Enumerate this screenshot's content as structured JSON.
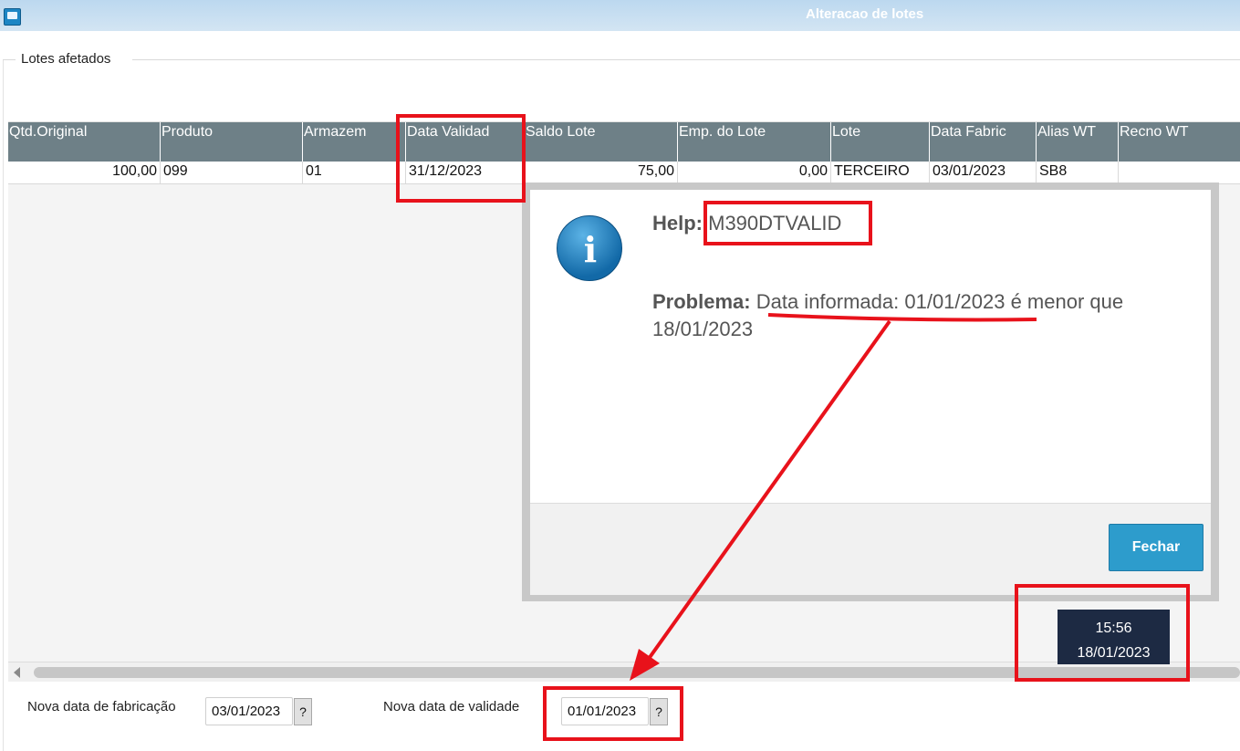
{
  "window": {
    "title": "Alteracao de lotes",
    "icon": "window-app-icon"
  },
  "group": {
    "label": "Lotes afetados"
  },
  "grid": {
    "columns": [
      "Qtd.Original",
      "Produto",
      "Armazem",
      "Data Validad",
      "Saldo Lote",
      "Emp. do Lote",
      "Lote",
      "Data Fabric",
      "Alias WT",
      "Recno WT"
    ],
    "rows": [
      [
        "100,00",
        "099",
        "01",
        "31/12/2023",
        "75,00",
        "0,00",
        "TERCEIRO",
        "03/01/2023",
        "SB8",
        ""
      ]
    ]
  },
  "form": {
    "fabricacao_label": "Nova data de fabricação",
    "fabricacao_value": "03/01/2023",
    "validade_label": "Nova data de validade",
    "validade_value": "01/01/2023",
    "help_button": "?"
  },
  "dialog": {
    "help_label": "Help:",
    "help_code": "M390DTVALID",
    "problem_label": "Problema:",
    "problem_text_highlight": "Data informada: 01/01/2023",
    "problem_text_rest": " é menor que 18/01/2023",
    "close_button": "Fechar",
    "icon": "info-icon"
  },
  "clock": {
    "time": "15:56",
    "date": "18/01/2023"
  },
  "colors": {
    "header_bg": "#6e8087",
    "accent": "#2d9ccc",
    "annotation": "#e8121b",
    "clock_bg": "#1d2a43"
  }
}
